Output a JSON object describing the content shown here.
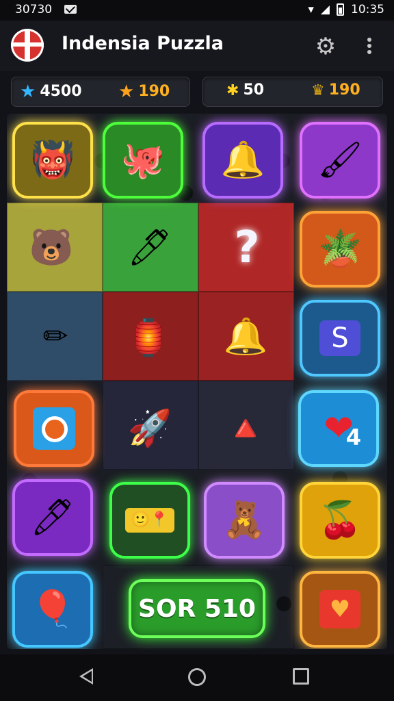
{
  "status_bar": {
    "time": "30730",
    "clock": "10:35"
  },
  "app_bar": {
    "title": "Indensia Puzzla",
    "gift_icon": "gift-icon",
    "settings_icon": "gear-icon",
    "menu_icon": "more-vert-icon"
  },
  "stats": [
    {
      "icon": "blue-star-icon",
      "value": "4500"
    },
    {
      "icon": "gold-star-icon",
      "value": "190"
    },
    {
      "icon": "sparkle-icon",
      "value": "50"
    },
    {
      "icon": "crown-icon",
      "value": "190"
    }
  ],
  "board": {
    "tiles": [
      {
        "name": "red-blob-monster",
        "glow": "#ffe14a",
        "fill": "#7c6a16",
        "emoji": "🐡"
      },
      {
        "name": "blue-octopus",
        "glow": "#4dff3b",
        "fill": "#2a8a26",
        "emoji": "🐙"
      },
      {
        "name": "bell-lamp",
        "glow": "#b86bff",
        "fill": "#5b2bb3",
        "emoji": "🔔"
      },
      {
        "name": "paint-brush",
        "glow": "#e071ff",
        "fill": "#8d38c9",
        "emoji": "🖌"
      },
      {
        "name": "yellow-bear-face",
        "glow": "none",
        "fill": "#a3a236",
        "emoji": "🐻"
      },
      {
        "name": "blue-pencil",
        "glow": "none",
        "fill": "#3b9b3a",
        "emoji": "🖊"
      },
      {
        "name": "question-mark",
        "glow": "none",
        "fill": "#a82626",
        "emoji": "?"
      },
      {
        "name": "potted-plant",
        "glow": "#ffa238",
        "fill": "#d2591a",
        "emoji": "🪴"
      },
      {
        "name": "green-pencil",
        "glow": "none",
        "fill": "#2e4a65",
        "emoji": "✏"
      },
      {
        "name": "golden-pagoda",
        "glow": "none",
        "fill": "#8e1e1e",
        "emoji": "🏮"
      },
      {
        "name": "golden-bell",
        "glow": "none",
        "fill": "#8e1e1e",
        "emoji": "🔔"
      },
      {
        "name": "lightning-box",
        "glow": "#4fc7ff",
        "fill": "#1c5a8e",
        "emoji": "⚡"
      },
      {
        "name": "target-button",
        "glow": "#ff7a3a",
        "fill": "#d9581a",
        "emoji": "🎯"
      },
      {
        "name": "rocket-pencil",
        "glow": "none",
        "fill": "#232432",
        "emoji": "🚀"
      },
      {
        "name": "gold-triangle",
        "glow": "none",
        "fill": "#232432",
        "emoji": "🔺"
      },
      {
        "name": "heart-tile",
        "glow": "#5fd8ff",
        "fill": "#1d8ed6",
        "emoji": "❤",
        "count": "4"
      },
      {
        "name": "purple-pencil",
        "glow": "#c46bff",
        "fill": "#7a2ac1",
        "emoji": "🖊"
      },
      {
        "name": "face-chips",
        "glow": "#3dff4a",
        "fill": "#1f4f23",
        "emoji": "🙂"
      },
      {
        "name": "cream-bear",
        "glow": "#d08bff",
        "fill": "#8a4fc8",
        "emoji": "🧸"
      },
      {
        "name": "red-berry-monster",
        "glow": "#ffd53a",
        "fill": "#e0a20a",
        "emoji": "🍒"
      },
      {
        "name": "red-balloon-face",
        "glow": "#45c7ff",
        "fill": "#1d6db2",
        "emoji": "🎈"
      },
      {
        "name": "heart-box",
        "glow": "#ffb640",
        "fill": "#a55612",
        "emoji": "💖"
      }
    ],
    "score_button": "SOR 510"
  },
  "nav_bar": {
    "back": "back-icon",
    "home": "home-icon",
    "recent": "recent-apps-icon"
  }
}
